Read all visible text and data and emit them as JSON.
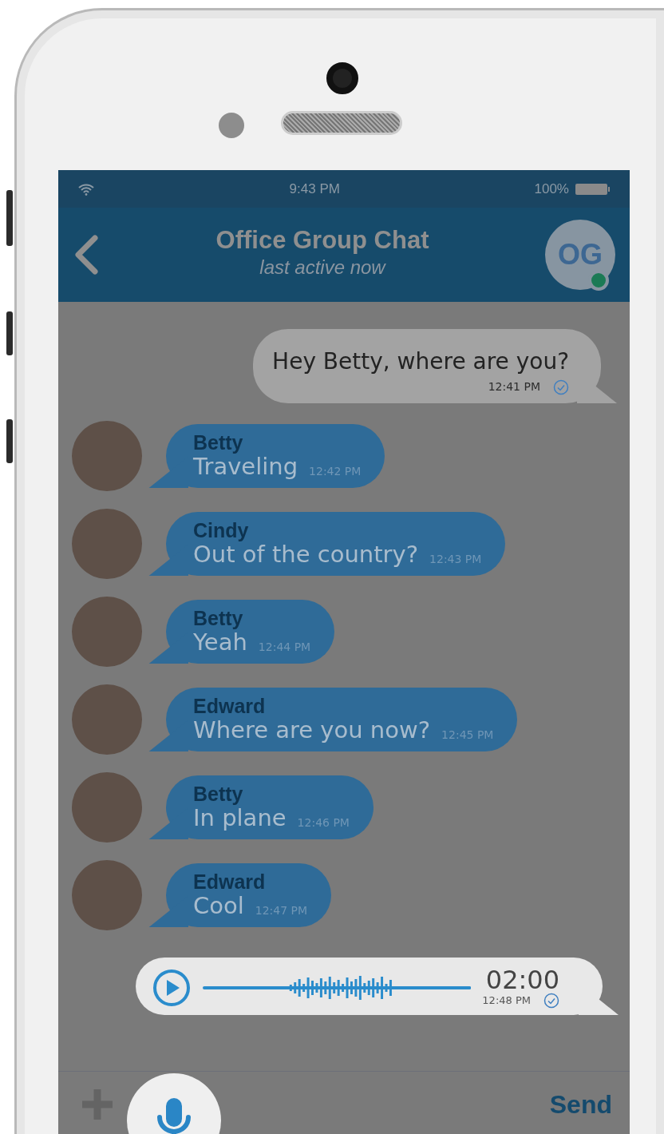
{
  "status_bar": {
    "time": "9:43 PM",
    "battery": "100%"
  },
  "header": {
    "title": "Office Group Chat",
    "subtitle": "last active now",
    "initials": "OG",
    "online": true
  },
  "messages": [
    {
      "kind": "outgoing",
      "text": "Hey Betty, where are you?",
      "time": "12:41 PM",
      "read": true
    },
    {
      "kind": "incoming",
      "sender": "Betty",
      "text": "Traveling",
      "time": "12:42 PM"
    },
    {
      "kind": "incoming",
      "sender": "Cindy",
      "text": "Out of the country?",
      "time": "12:43 PM"
    },
    {
      "kind": "incoming",
      "sender": "Betty",
      "text": "Yeah",
      "time": "12:44 PM"
    },
    {
      "kind": "incoming",
      "sender": "Edward",
      "text": "Where are you now?",
      "time": "12:45 PM"
    },
    {
      "kind": "incoming",
      "sender": "Betty",
      "text": "In plane",
      "time": "12:46 PM"
    },
    {
      "kind": "incoming",
      "sender": "Edward",
      "text": "Cool",
      "time": "12:47 PM"
    },
    {
      "kind": "voice",
      "duration": "02:00",
      "time": "12:48 PM",
      "read": true
    }
  ],
  "composer": {
    "send_label": "Send"
  }
}
